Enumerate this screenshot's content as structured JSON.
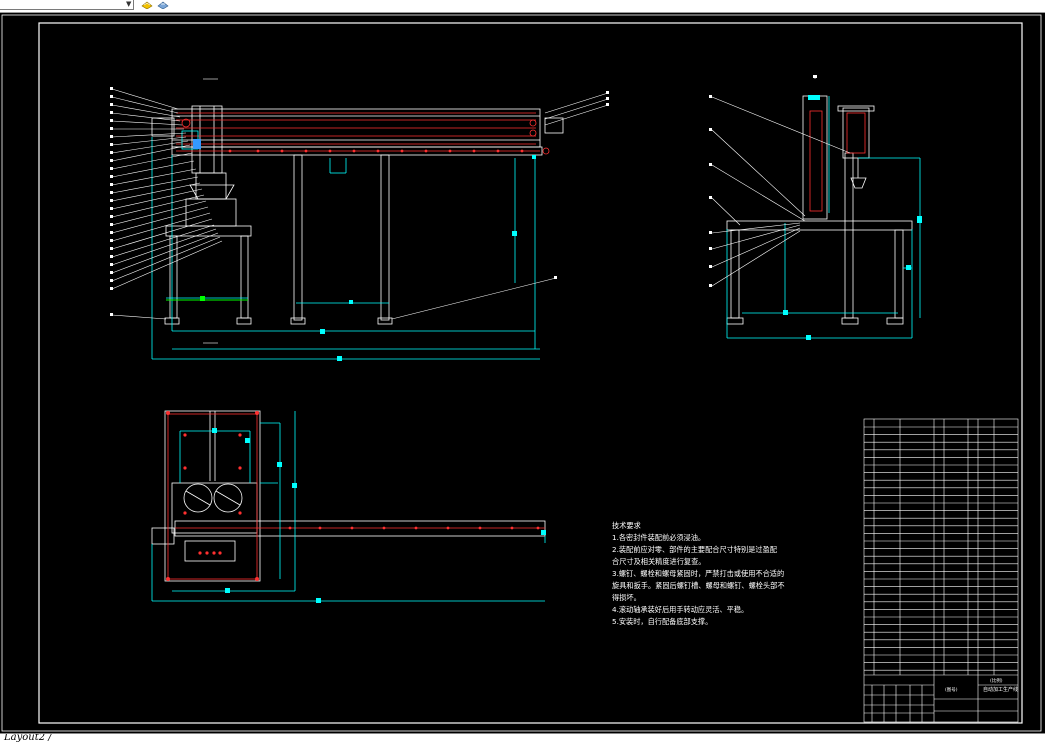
{
  "app": {
    "layout_tab_label": "Layout2 /"
  },
  "toolbar": {
    "layer_combo_value": "",
    "icons": [
      "layer-state-icon",
      "layer-match-icon"
    ]
  },
  "drawing": {
    "background": "#000000",
    "colors": {
      "object": "#ffffff",
      "dimension": "#00ffff",
      "hidden": "#ff3030",
      "centerline": "#ff0000",
      "accent_green": "#00ff00",
      "accent_blue": "#3399ff",
      "frame": "#ffffff"
    },
    "technical_requirements": {
      "heading": "技术要求",
      "lines": [
        "1.各密封件装配前必须浸油。",
        "2.装配前应对零、部件的主要配合尺寸特别是过盈配",
        "合尺寸及相关精度进行复查。",
        "3.螺钉、螺栓和螺母紧固时，严禁打击或使用不合适的",
        "旋具和扳手。紧固后螺钉槽、螺母和螺钉、螺栓头部不",
        "得损坏。",
        "4.滚动轴承装好后用手转动应灵活、平稳。",
        "5.安装时，自行配备底部支撑。"
      ]
    },
    "title_block": {
      "drawing_name": "自动加工生产线",
      "scale_label": "(比例)",
      "sheet_label": "(图号)"
    }
  }
}
